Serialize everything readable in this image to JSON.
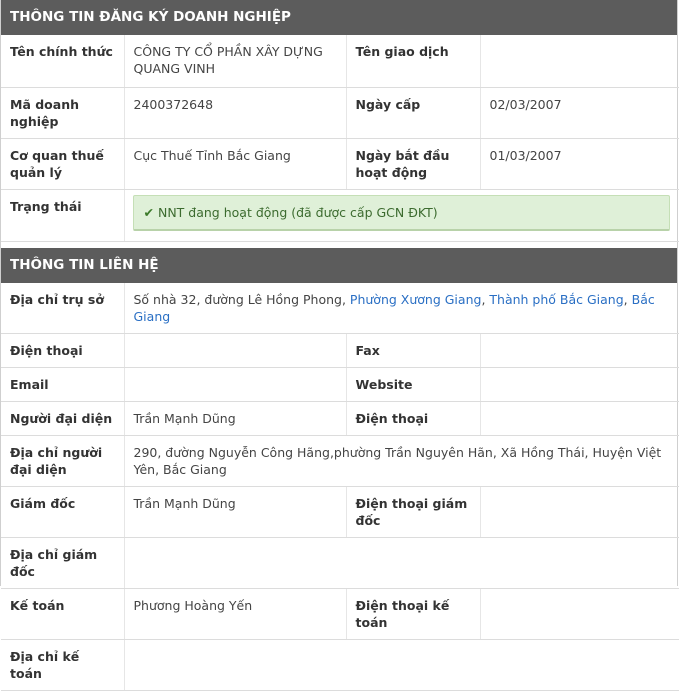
{
  "registration": {
    "title": "THÔNG TIN ĐĂNG KÝ DOANH NGHIỆP",
    "official_name_label": "Tên chính thức",
    "official_name_value": "CÔNG TY CỔ PHẦN XÂY DỰNG QUANG VINH",
    "trade_name_label": "Tên giao dịch",
    "trade_name_value": "",
    "tax_code_label": "Mã doanh nghiệp",
    "tax_code_value": "2400372648",
    "issue_date_label": "Ngày cấp",
    "issue_date_value": "02/03/2007",
    "tax_authority_label": "Cơ quan thuế quản lý",
    "tax_authority_value": "Cục Thuế Tỉnh Bắc Giang",
    "start_date_label": "Ngày bắt đầu hoạt động",
    "start_date_value": "01/03/2007",
    "status_label": "Trạng thái",
    "status_value": "NNT đang hoạt động (đã được cấp GCN ĐKT)",
    "status_color": "#dff0d8"
  },
  "contact": {
    "title": "THÔNG TIN LIÊN HỆ",
    "address_label": "Địa chỉ trụ sở",
    "address_street": "Số nhà 32, đường Lê Hồng Phong, ",
    "address_ward": "Phường Xương Giang",
    "address_sep1": ", ",
    "address_city": "Thành phố Bắc Giang",
    "address_sep2": ", ",
    "address_province": "Bắc Giang",
    "link_color": "#2a6fc4",
    "phone_label": "Điện thoại",
    "phone_value": "",
    "fax_label": "Fax",
    "fax_value": "",
    "email_label": "Email",
    "email_value": "",
    "website_label": "Website",
    "website_value": "",
    "rep_label": "Người đại diện",
    "rep_value": "Trần Mạnh Dũng",
    "rep_phone_label": "Điện thoại",
    "rep_phone_value": "",
    "rep_address_label": "Địa chỉ người đại diện",
    "rep_address_value": "290, đường Nguyễn Công Hãng,phường Trần Nguyên Hãn, Xã Hồng Thái, Huyện Việt Yên, Bắc Giang",
    "director_label": "Giám đốc",
    "director_value": "Trần Mạnh Dũng",
    "director_phone_label": "Điện thoại giám đốc",
    "director_phone_value": "",
    "director_address_label": "Địa chỉ giám đốc",
    "director_address_value": "",
    "accountant_label": "Kế toán",
    "accountant_value": "Phương Hoàng Yến",
    "accountant_phone_label": "Điện thoại kế toán",
    "accountant_phone_value": "",
    "accountant_address_label": "Địa chỉ kế toán",
    "accountant_address_value": ""
  }
}
